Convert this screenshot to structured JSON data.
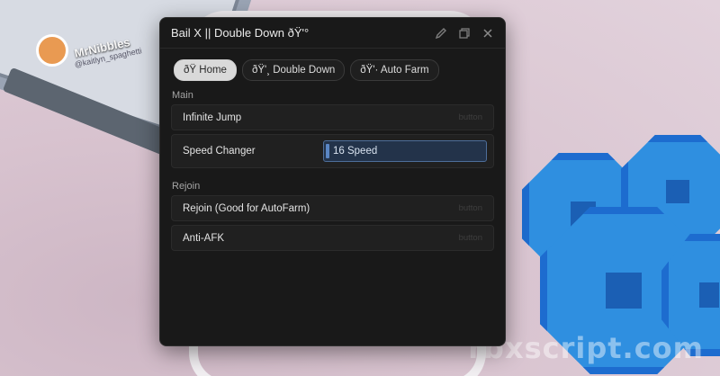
{
  "window": {
    "title": "Bail X || Double Down ðŸ'°"
  },
  "tabs": [
    {
      "label": "ðŸ  Home",
      "active": true
    },
    {
      "label": "ðŸ'¸ Double Down",
      "active": false
    },
    {
      "label": "ðŸ'· Auto Farm",
      "active": false
    }
  ],
  "sections": {
    "main": {
      "label": "Main",
      "infinite_jump": {
        "label": "Infinite Jump",
        "hint": "button"
      },
      "speed_changer": {
        "label": "Speed Changer",
        "value": "16 Speed"
      }
    },
    "rejoin": {
      "label": "Rejoin",
      "rejoin_button": {
        "label": "Rejoin (Good for AutoFarm)",
        "hint": "button"
      },
      "anti_afk": {
        "label": "Anti-AFK",
        "hint": "button"
      }
    }
  },
  "background": {
    "avatar_name": "MrNibbles",
    "avatar_handle": "@kaitlyn_spaghetti",
    "watermark": "rbxscript.com"
  },
  "colors": {
    "window_bg": "#191919",
    "active_tab": "#d9d9d9",
    "input_bg": "#23334a",
    "coin_blue": "#2f8fe0"
  },
  "icons": [
    "edit-icon",
    "copy-icon",
    "close-icon"
  ]
}
